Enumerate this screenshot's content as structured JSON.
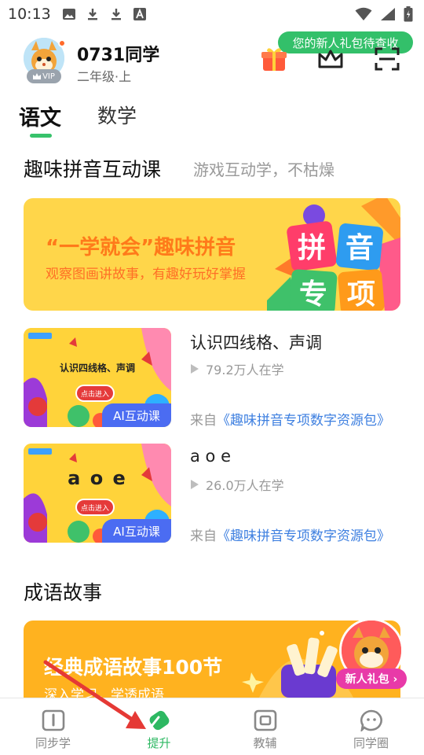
{
  "status_bar": {
    "time": "10:13"
  },
  "header": {
    "user_name": "0731同学",
    "grade": "二年级·上",
    "vip_label": "VIP",
    "gift_tip": "您的新人礼包待查收"
  },
  "tabs": [
    {
      "label": "语文",
      "active": true
    },
    {
      "label": "数学",
      "active": false
    }
  ],
  "sections": {
    "pinyin": {
      "title": "趣味拼音互动课",
      "subtitle": "游戏互动学，不枯燥",
      "banner_title": "“一学就会”趣味拼音",
      "banner_desc": "观察图画讲故事，有趣好玩好掌握",
      "banner_art_text": [
        "拼",
        "音",
        "专",
        "项"
      ]
    },
    "idiom": {
      "title": "成语故事",
      "banner_title": "经典成语故事100节",
      "banner_sub": "深入学习，学透成语",
      "newbie_badge": "新人礼包 ›"
    }
  },
  "courses": [
    {
      "thumb_text": "认识四线格、声调",
      "thumb_button": "点击进入",
      "badge": "AI互动课",
      "title": "认识四线格、声调",
      "learners": "79.2万人在学",
      "source_prefix": "来自",
      "source_link": "《趣味拼音专项数字资源包》"
    },
    {
      "thumb_text": "a o e",
      "thumb_button": "点击进入",
      "badge": "AI互动课",
      "title": "a o e",
      "learners": "26.0万人在学",
      "source_prefix": "来自",
      "source_link": "《趣味拼音专项数字资源包》"
    }
  ],
  "bottom_nav": [
    {
      "label": "同步学",
      "icon": "book-icon",
      "active": false
    },
    {
      "label": "提升",
      "icon": "eraser-icon",
      "active": true
    },
    {
      "label": "教辅",
      "icon": "box-icon",
      "active": false
    },
    {
      "label": "同学圈",
      "icon": "chat-face-icon",
      "active": false
    }
  ],
  "colors": {
    "accent_green": "#37c26b",
    "link_blue": "#3d7fe0",
    "ai_badge_blue": "#4b6cf2",
    "banner_yellow": "#ffd64a",
    "annotation_red": "#e53935"
  }
}
